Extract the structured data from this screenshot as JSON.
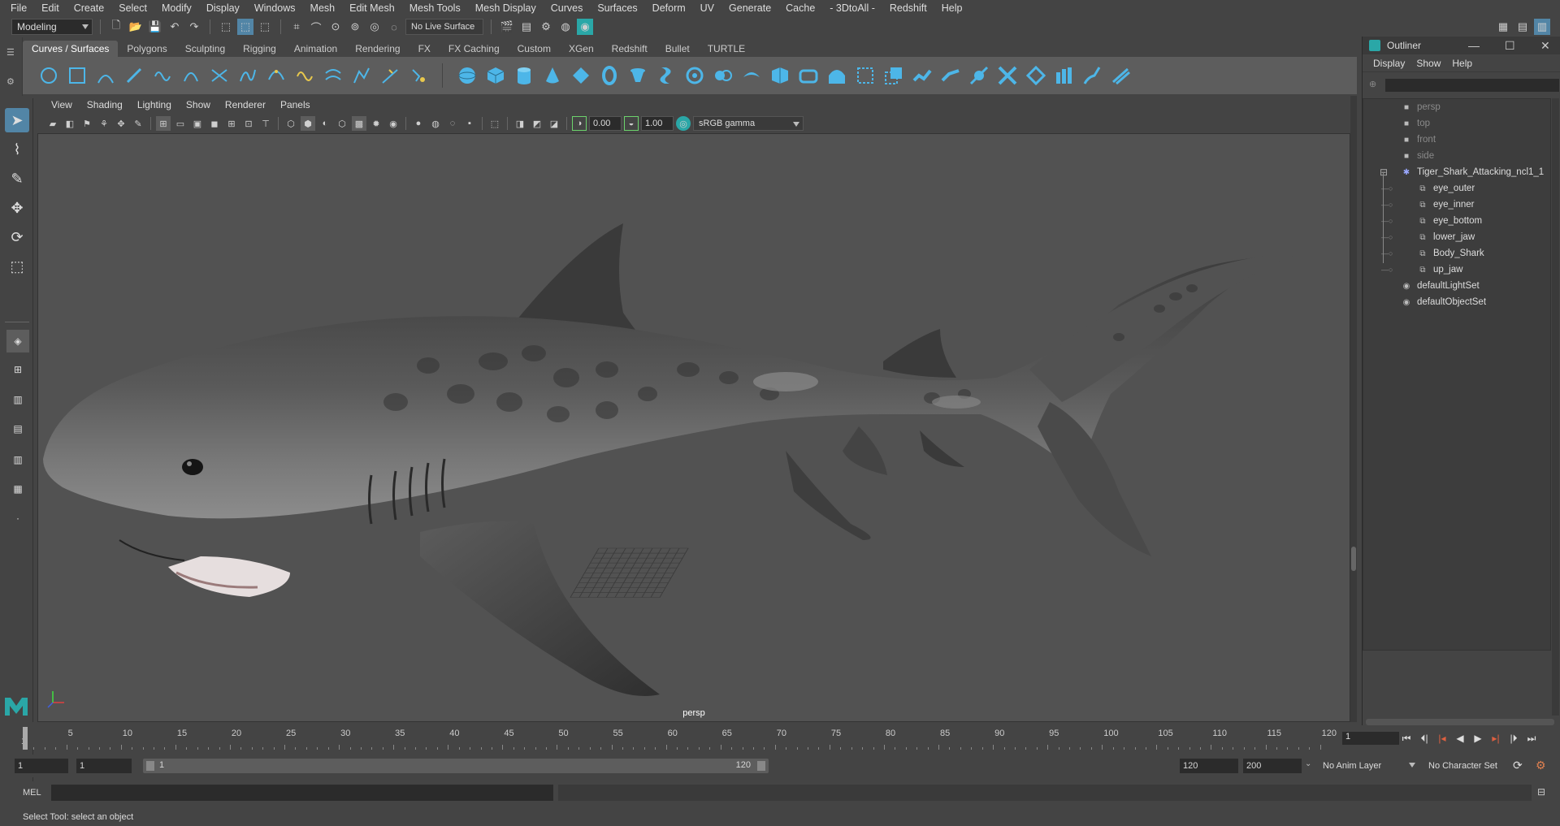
{
  "menubar": {
    "items": [
      "File",
      "Edit",
      "Create",
      "Select",
      "Modify",
      "Display",
      "Windows",
      "Mesh",
      "Edit Mesh",
      "Mesh Tools",
      "Mesh Display",
      "Curves",
      "Surfaces",
      "Deform",
      "UV",
      "Generate",
      "Cache",
      "- 3DtoAll -",
      "Redshift",
      "Help"
    ]
  },
  "status": {
    "mode": "Modeling",
    "live_surface": "No Live Surface"
  },
  "shelf": {
    "tabs": [
      "Curves / Surfaces",
      "Polygons",
      "Sculpting",
      "Rigging",
      "Animation",
      "Rendering",
      "FX",
      "FX Caching",
      "Custom",
      "XGen",
      "Redshift",
      "Bullet",
      "TURTLE"
    ],
    "active_tab": "Curves / Surfaces"
  },
  "panel": {
    "menus": [
      "View",
      "Shading",
      "Lighting",
      "Show",
      "Renderer",
      "Panels"
    ],
    "exposure": "0.00",
    "gamma": "1.00",
    "color_space": "sRGB gamma",
    "camera_label": "persp"
  },
  "outliner": {
    "title": "Outliner",
    "menus": [
      "Display",
      "Show",
      "Help"
    ],
    "items": [
      {
        "label": "persp",
        "icon": "camera-icon",
        "dim": true,
        "indent": 0
      },
      {
        "label": "top",
        "icon": "camera-icon",
        "dim": true,
        "indent": 0
      },
      {
        "label": "front",
        "icon": "camera-icon",
        "dim": true,
        "indent": 0
      },
      {
        "label": "side",
        "icon": "camera-icon",
        "dim": true,
        "indent": 0
      },
      {
        "label": "Tiger_Shark_Attacking_ncl1_1",
        "icon": "group-icon",
        "dim": false,
        "indent": 0
      },
      {
        "label": "eye_outer",
        "icon": "mesh-icon",
        "dim": false,
        "indent": 1
      },
      {
        "label": "eye_inner",
        "icon": "mesh-icon",
        "dim": false,
        "indent": 1
      },
      {
        "label": "eye_bottom",
        "icon": "mesh-icon",
        "dim": false,
        "indent": 1
      },
      {
        "label": "lower_jaw",
        "icon": "mesh-icon",
        "dim": false,
        "indent": 1
      },
      {
        "label": "Body_Shark",
        "icon": "mesh-icon",
        "dim": false,
        "indent": 1
      },
      {
        "label": "up_jaw",
        "icon": "mesh-icon",
        "dim": false,
        "indent": 1
      },
      {
        "label": "defaultLightSet",
        "icon": "set-icon",
        "dim": false,
        "indent": 0
      },
      {
        "label": "defaultObjectSet",
        "icon": "set-icon",
        "dim": false,
        "indent": 0
      }
    ]
  },
  "timeline": {
    "ticks": [
      "5",
      "10",
      "15",
      "20",
      "25",
      "30",
      "35",
      "40",
      "45",
      "50",
      "55",
      "60",
      "65",
      "70",
      "75",
      "80",
      "85",
      "90",
      "95",
      "100",
      "105",
      "110",
      "115",
      "120"
    ],
    "start_marker": "1",
    "current_frame": "1"
  },
  "range": {
    "start": "1",
    "playback_start": "1",
    "slider_start": "1",
    "slider_end": "120",
    "playback_end": "120",
    "end": "200",
    "anim_layer": "No Anim Layer",
    "character_set": "No Character Set"
  },
  "command": {
    "label": "MEL"
  },
  "help": {
    "text": "Select Tool: select an object"
  },
  "colors": {
    "accent": "#5285a6",
    "shelf_bg": "#5d5d5d",
    "viewport_bg": "#525252",
    "maya_teal": "#2aa7a7"
  }
}
